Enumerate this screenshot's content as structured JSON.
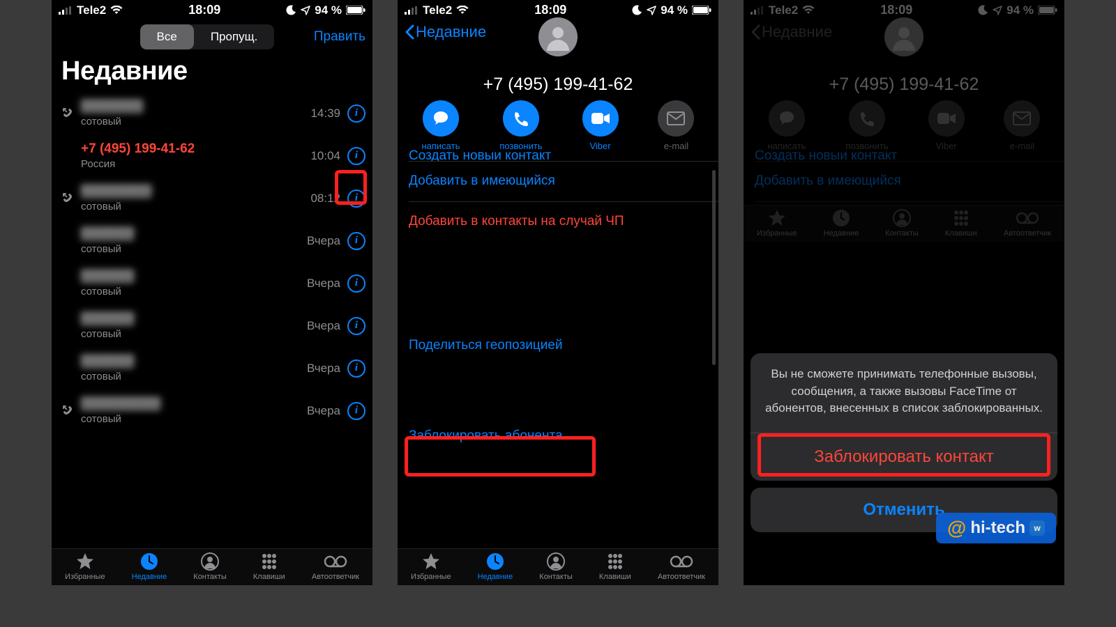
{
  "status": {
    "carrier": "Tele2",
    "time": "18:09",
    "battery": "94 %"
  },
  "s1": {
    "seg_all": "Все",
    "seg_missed": "Пропущ.",
    "edit": "Править",
    "title": "Недавние",
    "calls": [
      {
        "name": "blurred",
        "sub": "сотовый",
        "time": "14:39",
        "outgoing": true,
        "missed": false
      },
      {
        "name": "+7 (495) 199-41-62",
        "sub": "Россия",
        "time": "10:04",
        "outgoing": false,
        "missed": true
      },
      {
        "name": "blurred",
        "sub": "сотовый",
        "time": "08:12",
        "outgoing": true,
        "missed": false
      },
      {
        "name": "blurred",
        "sub": "сотовый",
        "time": "Вчера",
        "outgoing": false,
        "missed": false
      },
      {
        "name": "blurred",
        "sub": "сотовый",
        "time": "Вчера",
        "outgoing": false,
        "missed": false
      },
      {
        "name": "blurred",
        "sub": "сотовый",
        "time": "Вчера",
        "outgoing": false,
        "missed": false
      },
      {
        "name": "blurred",
        "sub": "сотовый",
        "time": "Вчера",
        "outgoing": false,
        "missed": false
      },
      {
        "name": "blurred",
        "sub": "сотовый",
        "time": "Вчера",
        "outgoing": true,
        "missed": false
      }
    ]
  },
  "tabs": {
    "fav": "Избранные",
    "recent": "Недавние",
    "contacts": "Контакты",
    "keypad": "Клавиши",
    "vm": "Автоответчик"
  },
  "s2": {
    "back": "Недавние",
    "phone": "+7 (495) 199-41-62",
    "actions": {
      "message": "написать",
      "call": "позвонить",
      "viber": "Viber",
      "email": "e-mail"
    },
    "rows": {
      "create_cut": "Создать новыи контакт",
      "add_existing": "Добавить в имеющийся",
      "emergency": "Добавить в контакты на случай ЧП",
      "share_loc": "Поделиться геопозицией",
      "block": "Заблокировать абонента"
    }
  },
  "sheet": {
    "message": "Вы не сможете принимать телефонные вызовы, сообщения, а также вызовы FaceTime от абонентов, внесенных в список заблокированных.",
    "block": "Заблокировать контакт",
    "cancel": "Отменить"
  },
  "watermark": "hi-tech"
}
